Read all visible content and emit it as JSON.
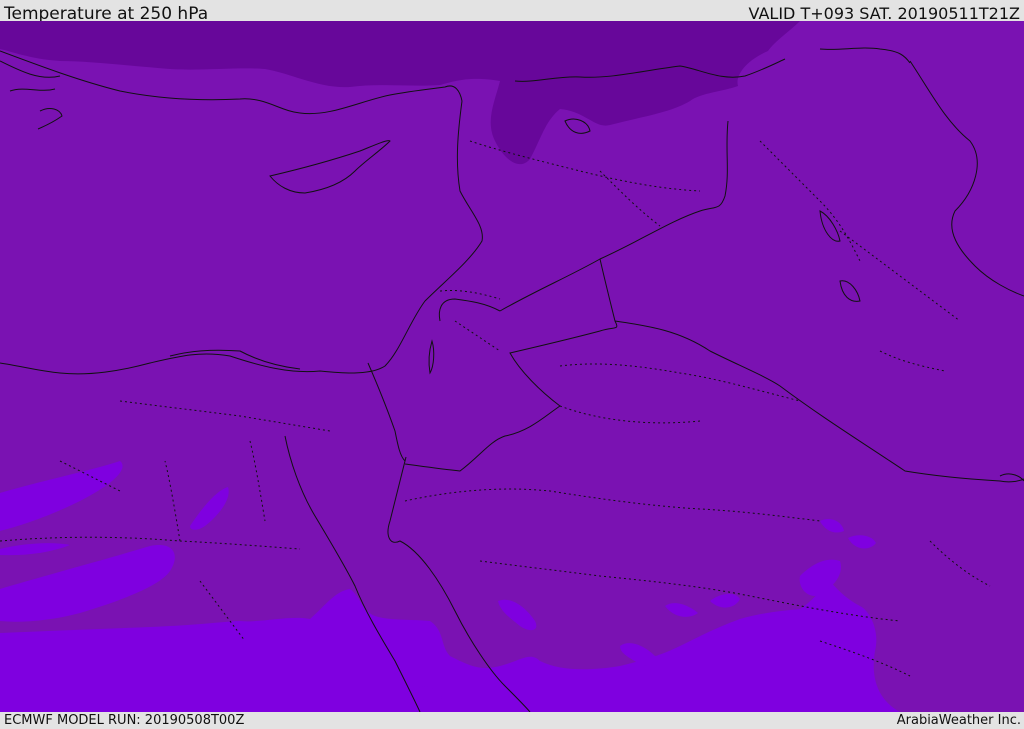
{
  "header": {
    "title": "Temperature at 250 hPa",
    "valid": "VALID T+093 SAT. 20190511T21Z"
  },
  "footer": {
    "model_run": "ECMWF MODEL RUN: 20190508T00Z",
    "credit": "ArabiaWeather Inc."
  },
  "colors": {
    "base_field": "#7a12b2",
    "cold_field": "#67079a",
    "warm_field": "#7f00e0",
    "borders": "#111111"
  }
}
